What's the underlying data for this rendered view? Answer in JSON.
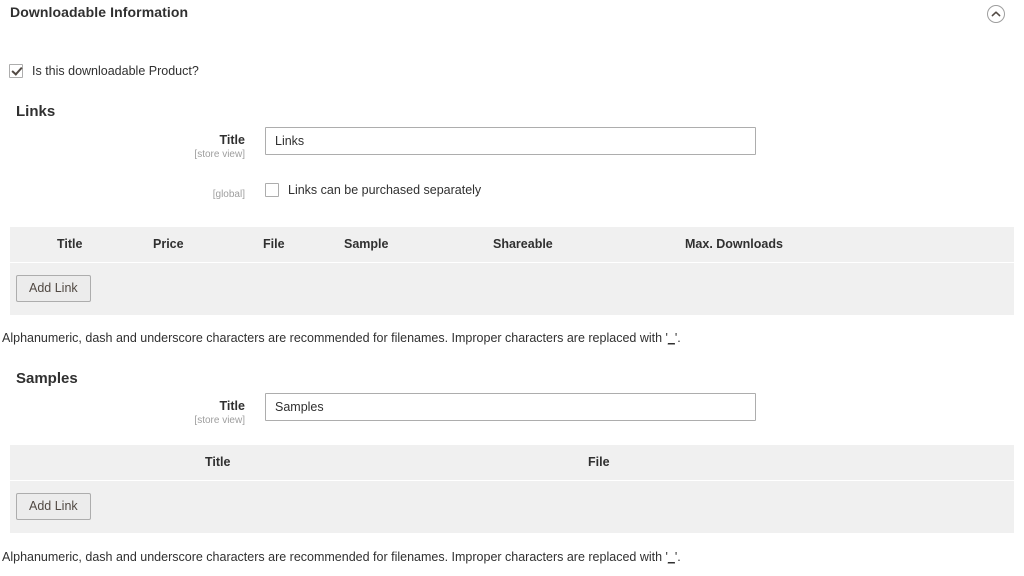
{
  "section": {
    "title": "Downloadable Information",
    "collapse_icon": "chevron-up-circle-icon"
  },
  "downloadable_toggle": {
    "label": "Is this downloadable Product?",
    "checked": true
  },
  "links": {
    "heading": "Links",
    "title_field": {
      "label": "Title",
      "scope": "[store view]",
      "value": "Links",
      "placeholder": ""
    },
    "purchase_separately": {
      "scope": "[global]",
      "label": "Links can be purchased separately",
      "checked": false
    },
    "table": {
      "columns": [
        "Title",
        "Price",
        "File",
        "Sample",
        "Shareable",
        "Max. Downloads"
      ],
      "rows": [],
      "add_button": "Add Link"
    },
    "note_prefix": "Alphanumeric, dash and underscore characters are recommended for filenames. Improper characters are replaced with '",
    "note_underscore": "_",
    "note_suffix": "'."
  },
  "samples": {
    "heading": "Samples",
    "title_field": {
      "label": "Title",
      "scope": "[store view]",
      "value": "Samples",
      "placeholder": ""
    },
    "table": {
      "columns": [
        "Title",
        "File"
      ],
      "rows": [],
      "add_button": "Add Link"
    },
    "note_prefix": "Alphanumeric, dash and underscore characters are recommended for filenames. Improper characters are replaced with '",
    "note_underscore": "_",
    "note_suffix": "'."
  },
  "colors": {
    "page_bg": "#ffffff",
    "grid_bg": "#f0f0f0",
    "grid_head_bg": "#f0f0f0",
    "text": "#303030",
    "muted": "#9e9e9e",
    "border": "#adadad",
    "button_bg": "#ececec"
  }
}
